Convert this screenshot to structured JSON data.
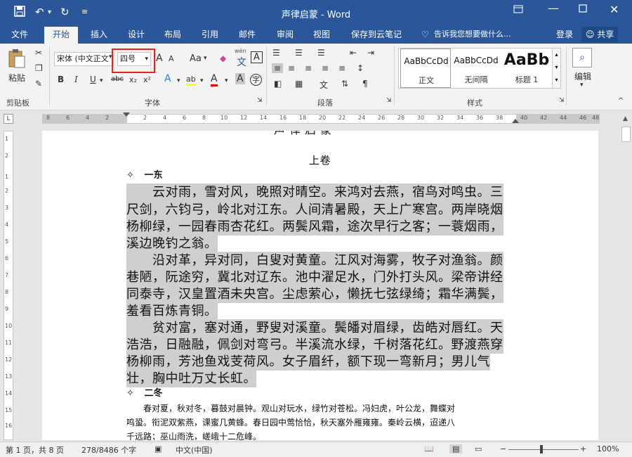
{
  "title_bar": {
    "doc_title": "声律启蒙 - Word",
    "save_icon": "save-icon",
    "undo_icon": "undo-icon",
    "redo_icon": "redo-icon",
    "customize_icon": "customize-qa-icon",
    "ribbon_display_icon": "ribbon-display-icon",
    "minimize_icon": "minimize-icon",
    "maximize_icon": "maximize-icon",
    "close_icon": "close-icon"
  },
  "tabs": [
    {
      "label": "文件"
    },
    {
      "label": "开始",
      "active": true
    },
    {
      "label": "插入"
    },
    {
      "label": "设计"
    },
    {
      "label": "布局"
    },
    {
      "label": "引用"
    },
    {
      "label": "邮件"
    },
    {
      "label": "审阅"
    },
    {
      "label": "视图"
    },
    {
      "label": "保存到云笔记"
    }
  ],
  "tell_me": "告诉我您想要做什么...",
  "signin": "登录",
  "share": "共享",
  "ribbon": {
    "paste_label": "粘贴",
    "clipboard_label": "剪贴板",
    "font_group_label": "字体",
    "paragraph_group_label": "段落",
    "styles_group_label": "样式",
    "editing_label": "编辑",
    "font_name": "宋体 (中文正文",
    "font_size": "四号",
    "bold": "B",
    "italic": "I",
    "underline": "U",
    "strikethrough": "abc",
    "subscript": "x₂",
    "superscript": "x²",
    "change_case": "Aa",
    "grow_font": "A",
    "shrink_font": "A",
    "wen_label": "wén",
    "wen_char": "文",
    "char_border": "A",
    "text_effect": "A",
    "highlight": "ab",
    "font_color": "A",
    "char_shade": "A",
    "enclosed_char": "字",
    "styles": [
      {
        "sample": "AaBbCcDd",
        "name": "正文"
      },
      {
        "sample": "AaBbCcDd",
        "name": "无间隔"
      },
      {
        "sample": "AaBb",
        "name": "标题 1"
      }
    ]
  },
  "ruler_h": [
    "8",
    "6",
    "4",
    "2",
    "2",
    "4",
    "6",
    "8",
    "10",
    "12",
    "14",
    "16",
    "18",
    "20",
    "22",
    "24",
    "26",
    "28",
    "30",
    "32",
    "34",
    "36",
    "38",
    "40",
    "42",
    "44",
    "46",
    "48"
  ],
  "ruler_v": [
    "1",
    "2",
    "1",
    "2",
    "3",
    "4",
    "5",
    "6",
    "7",
    "8",
    "9",
    "10",
    "11",
    "12",
    "13",
    "14",
    "15",
    "16",
    "17"
  ],
  "document": {
    "top_partial": "声 律 启 蒙",
    "heading": "上卷",
    "sec1_marker": "✧",
    "sec1_title": "一东",
    "para_lines": [
      "　　云对雨，雪对风，晚照对晴空。来鸿对去燕，宿鸟对鸣虫。三",
      "尺剑，六钧弓，岭北对江东。人间清暑殿，天上广寒宫。两岸晓烟",
      "杨柳绿，一园春雨杏花红。两鬓风霜，途次早行之客；一蓑烟雨，",
      "溪边晚钓之翁。",
      "　　沿对革，异对同，白叟对黄童。江风对海雾，牧子对渔翁。颜",
      "巷陋，阮途穷，冀北对辽东。池中濯足水，门外打头风。梁帝讲经",
      "同泰寺，汉皇置酒未央宫。尘虑萦心，懒抚七弦绿绮；霜华满鬓，",
      "羞看百炼青铜。",
      "　　贫对富，塞对通，野叟对溪童。鬓皤对眉绿，齿皓对唇红。天",
      "浩浩，日融融，佩剑对弯弓。半溪流水绿，千树落花红。野渡燕穿",
      "杨柳雨，芳池鱼戏芰荷风。女子眉纤，额下现一弯新月；男儿气",
      "壮，胸中吐万丈长虹。"
    ],
    "sec2_marker": "✧",
    "sec2_title": "二冬",
    "small_lines": [
      "　　春对夏，秋对冬，暮鼓对晨钟。观山对玩水，绿竹对苍松。冯妇虎，叶公龙，舞蝶对",
      "鸣蛩。衔泥双紫燕，课蜜几黄蜂。春日园中莺恰恰，秋天塞外雁雍雍。秦岭云横，迢递八",
      "千远路；巫山雨洗，嵯峨十二危峰。"
    ]
  },
  "statusbar": {
    "page": "第 1 页，共 8 页",
    "words": "278/8486 个字",
    "lang": "中文(中国)",
    "zoom": "100%"
  }
}
